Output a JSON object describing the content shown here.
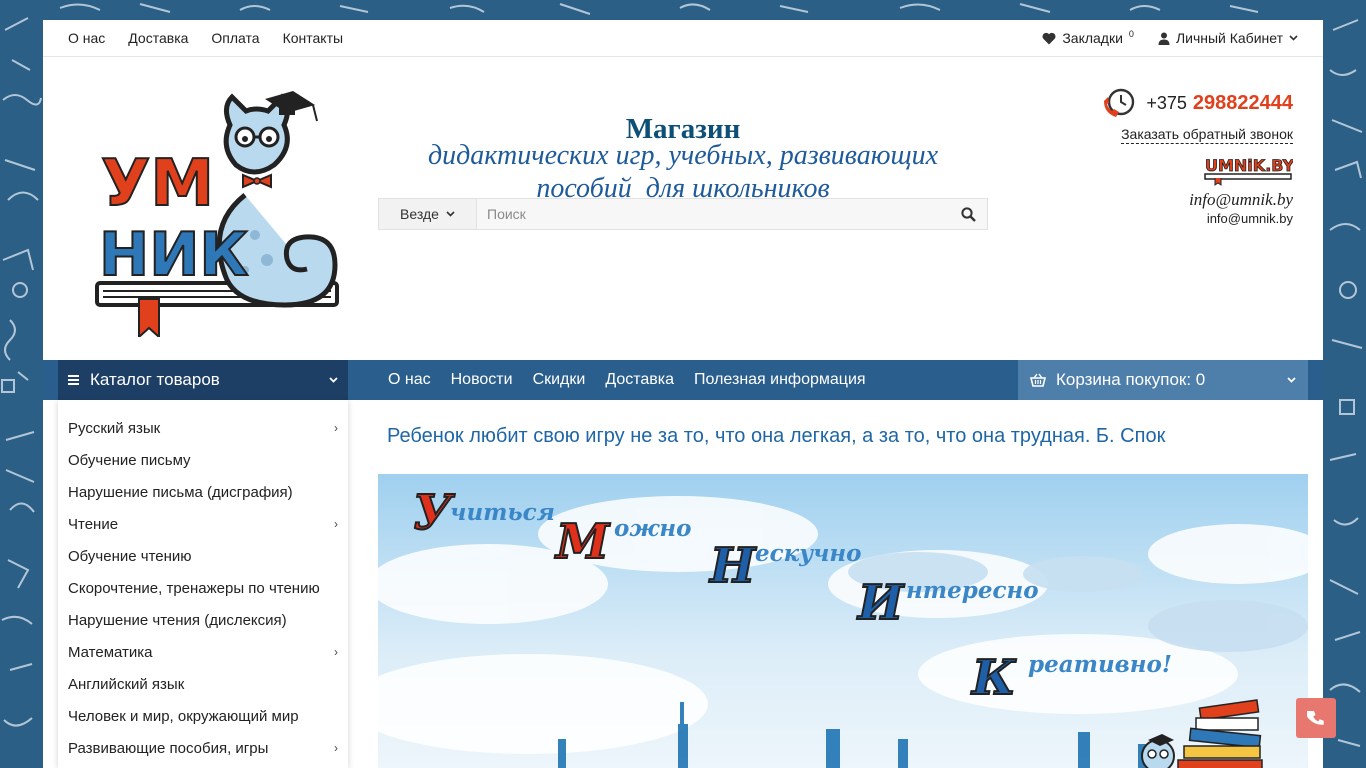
{
  "colors": {
    "background": "#2b5f86",
    "nav_bar": "#2a5f8d",
    "catalog_head": "#1d3f66",
    "cart_bg": "#4e7faa",
    "phone_accent": "#e0401c",
    "title_blue": "#0d4f76",
    "quote_blue": "#1e66a6"
  },
  "topbar": {
    "links": [
      "О нас",
      "Доставка",
      "Оплата",
      "Контакты"
    ],
    "bookmarks_label": "Закладки",
    "bookmarks_count": "0",
    "account_label": "Личный Кабинет"
  },
  "header": {
    "logo_text_top": "УМ",
    "logo_text_bottom": "НИК",
    "title": "Магазин",
    "subtitle_line1": "дидактических игр, учебных, развивающих",
    "subtitle_line2": "пособий  для школьников"
  },
  "search": {
    "scope": "Везде",
    "placeholder": "Поиск"
  },
  "contact": {
    "phone_code": "+375",
    "phone_number": "298822444",
    "callback": "Заказать обратный звонок",
    "site_logo": "UMNiK.BY",
    "email_italic": "info@umnik.by",
    "email": "info@umnik.by"
  },
  "nav": {
    "catalog": "Каталог товаров",
    "links": [
      "О нас",
      "Новости",
      "Скидки",
      "Доставка",
      "Полезная информация"
    ],
    "cart": "Корзина покупок: 0"
  },
  "sidebar": {
    "categories": [
      {
        "label": "Русский язык",
        "has_children": true
      },
      {
        "label": "Обучение письму",
        "has_children": false
      },
      {
        "label": "Нарушение письма (дисграфия)",
        "has_children": false
      },
      {
        "label": "Чтение",
        "has_children": true
      },
      {
        "label": "Обучение чтению",
        "has_children": false
      },
      {
        "label": "Скорочтение, тренажеры по чтению",
        "has_children": false
      },
      {
        "label": "Нарушение чтения (дислексия)",
        "has_children": false
      },
      {
        "label": "Математика",
        "has_children": true
      },
      {
        "label": "Английский язык",
        "has_children": false
      },
      {
        "label": "Человек и мир, окружающий мир",
        "has_children": false
      },
      {
        "label": "Развивающие пособия, игры",
        "has_children": true
      }
    ]
  },
  "main": {
    "quote": "Ребенок любит свою игру не за то, что она легкая, а за то, что она трудная. Б. Спок"
  },
  "banner": {
    "words": [
      {
        "letter": "У",
        "rest": "читься"
      },
      {
        "letter": "М",
        "rest": "ожно"
      },
      {
        "letter": "Н",
        "rest": "ескучно"
      },
      {
        "letter": "И",
        "rest": "нтересно"
      },
      {
        "letter": "К",
        "rest": "реативно!"
      }
    ]
  },
  "icons": {
    "bookmarks": "heart-icon",
    "account": "user-icon",
    "search": "search-icon",
    "phone": "clock-phone-icon",
    "cart": "basket-icon",
    "call": "phone-icon"
  }
}
